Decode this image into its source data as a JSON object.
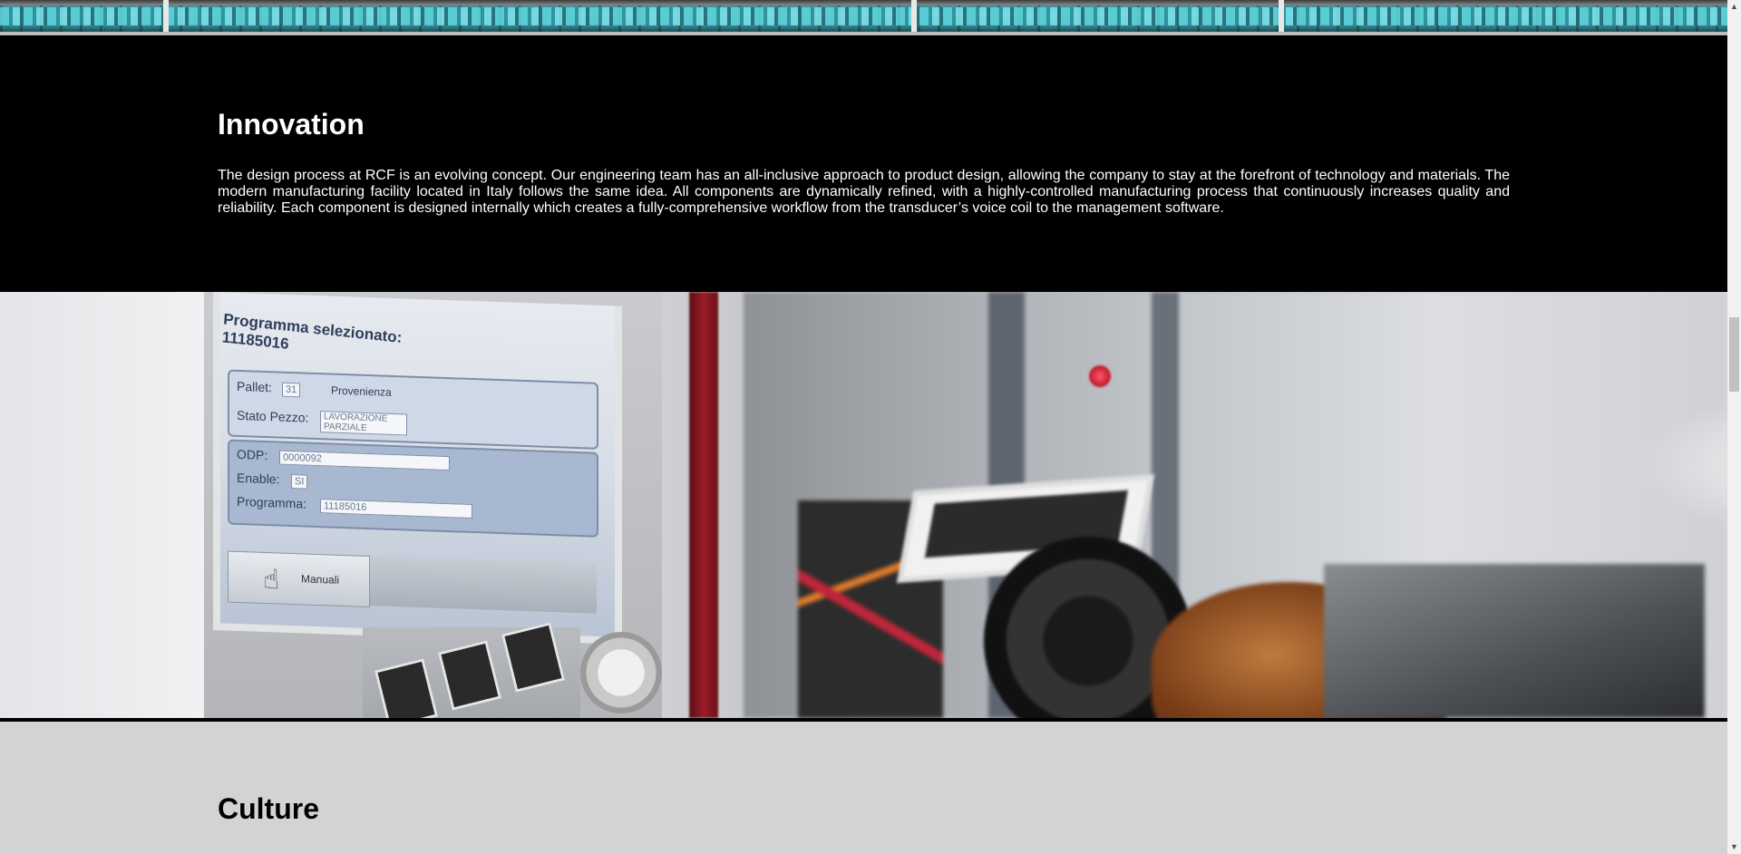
{
  "innovation": {
    "title": "Innovation",
    "body": "The design process at RCF is an evolving concept. Our engineering team has an all-inclusive approach to product design, allowing the company to stay at the forefront of technology and materials. The modern manufacturing facility located in Italy follows the same idea. All components are dynamically refined, with a highly-controlled manufacturing process that continuously increases quality and reliability. Each component is designed internally which creates a fully-comprehensive workflow from the transducer’s voice coil to the management software."
  },
  "photo": {
    "screen": {
      "title_line1": "Programma selezionato:",
      "title_line2": "11185016",
      "pallet_label": "Pallet:",
      "pallet_value": "31",
      "provenienza_label": "Provenienza",
      "stato_label": "Stato Pezzo:",
      "stato_value": "LAVORAZIONE PARZIALE",
      "odp_label": "ODP:",
      "odp_value": "0000092",
      "enable_label": "Enable:",
      "enable_value": "SI",
      "programma_label": "Programma:",
      "programma_value": "11185016",
      "manuali_label": "Manuali"
    }
  },
  "culture": {
    "title": "Culture"
  },
  "scrollbar": {
    "up_glyph": "▲",
    "down_glyph": "▼"
  },
  "colors": {
    "innovation_bg": "#000000",
    "culture_bg": "#d3d3d3",
    "text_light": "#ffffff",
    "text_dark": "#000000"
  }
}
